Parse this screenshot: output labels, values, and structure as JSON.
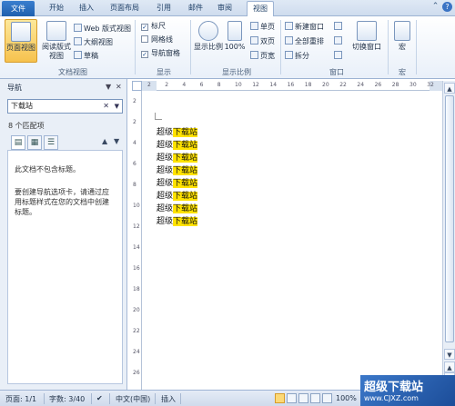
{
  "tabs": [
    "文件",
    "开始",
    "插入",
    "页面布局",
    "引用",
    "邮件",
    "审阅",
    "视图"
  ],
  "active_tab": "视图",
  "window_controls": [
    "minimize-icon",
    "help-icon"
  ],
  "ribbon": {
    "views_group": {
      "label": "文档视图",
      "page_view": "页面视图",
      "read_view_1": "阅读版式",
      "read_view_2": "视图",
      "web_view": "Web 版式视图",
      "outline_view": "大纲视图",
      "draft_view": "草稿"
    },
    "show_group": {
      "label": "显示",
      "ruler": "标尺",
      "ruler_checked": true,
      "gridlines": "网格线",
      "gridlines_checked": false,
      "nav_pane": "导航窗格",
      "nav_pane_checked": true
    },
    "zoom_group": {
      "label": "显示比例",
      "zoom": "显示比例",
      "percent": "100%",
      "one_page": "单页",
      "two_pages": "双页",
      "page_width": "页宽"
    },
    "window_group": {
      "label": "窗口",
      "new_window": "新建窗口",
      "arrange_all": "全部重排",
      "split": "拆分",
      "switch_window": "切换窗口"
    },
    "macro_group": {
      "label": "宏",
      "macro": "宏"
    }
  },
  "nav_pane": {
    "title": "导航",
    "search_value": "下载站",
    "matches": "8 个匹配项",
    "message_1": "此文档不包含标题。",
    "message_2": "要创建导航选项卡，请通过应用标题样式在您的文档中创建标题。"
  },
  "ruler": {
    "ticks": [
      "2",
      "2",
      "4",
      "6",
      "8",
      "10",
      "12",
      "14",
      "16",
      "18",
      "20",
      "22",
      "24",
      "26",
      "28",
      "30",
      "32"
    ],
    "vticks": [
      "2",
      "2",
      "4",
      "6",
      "8",
      "10",
      "12",
      "14",
      "16",
      "18",
      "20",
      "22",
      "24",
      "26"
    ]
  },
  "document": {
    "lines": [
      {
        "plain": "超级",
        "highlight": "下载站"
      },
      {
        "plain": "超级",
        "highlight": "下载站"
      },
      {
        "plain": "超级",
        "highlight": "下载站"
      },
      {
        "plain": "超级",
        "highlight": "下载站"
      },
      {
        "plain": "超级",
        "highlight": "下载站"
      },
      {
        "plain": "超级",
        "highlight": "下载站"
      },
      {
        "plain": "超级",
        "highlight": "下载站"
      },
      {
        "plain": "超级",
        "highlight": "下载站"
      }
    ],
    "highlight_color": "#ffe200"
  },
  "status": {
    "page": "页面: 1/1",
    "words": "字数: 3/40",
    "language": "中文(中国)",
    "mode": "插入",
    "zoom": "100%"
  },
  "watermark": {
    "line1": "超级下载站",
    "line2": "www.CJXZ.com"
  }
}
